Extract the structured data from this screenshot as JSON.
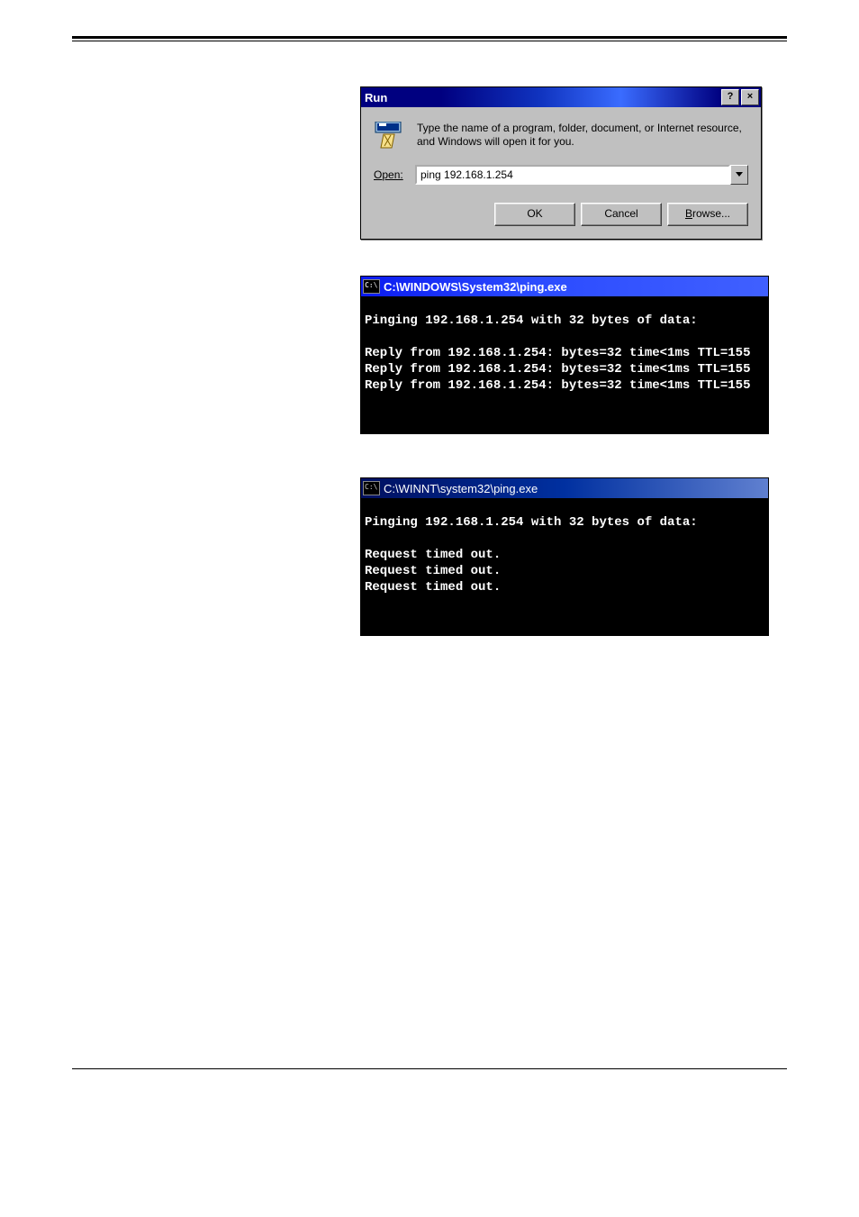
{
  "run_dialog": {
    "title": "Run",
    "help_btn": "?",
    "close_btn": "×",
    "description": "Type the name of a program, folder, document, or Internet resource, and Windows will open it for you.",
    "open_label_prefix": "O",
    "open_label_rest": "pen:",
    "open_value": "ping 192.168.1.254",
    "ok_label": "OK",
    "cancel_label": "Cancel",
    "browse_prefix": "B",
    "browse_rest": "rowse..."
  },
  "console1": {
    "title": "C:\\WINDOWS\\System32\\ping.exe",
    "lines": [
      "Pinging 192.168.1.254 with 32 bytes of data:",
      "",
      "Reply from 192.168.1.254: bytes=32 time<1ms TTL=155",
      "Reply from 192.168.1.254: bytes=32 time<1ms TTL=155",
      "Reply from 192.168.1.254: bytes=32 time<1ms TTL=155"
    ]
  },
  "console2": {
    "title": "C:\\WINNT\\system32\\ping.exe",
    "lines": [
      "Pinging 192.168.1.254 with 32 bytes of data:",
      "",
      "Request timed out.",
      "Request timed out.",
      "Request timed out."
    ]
  }
}
